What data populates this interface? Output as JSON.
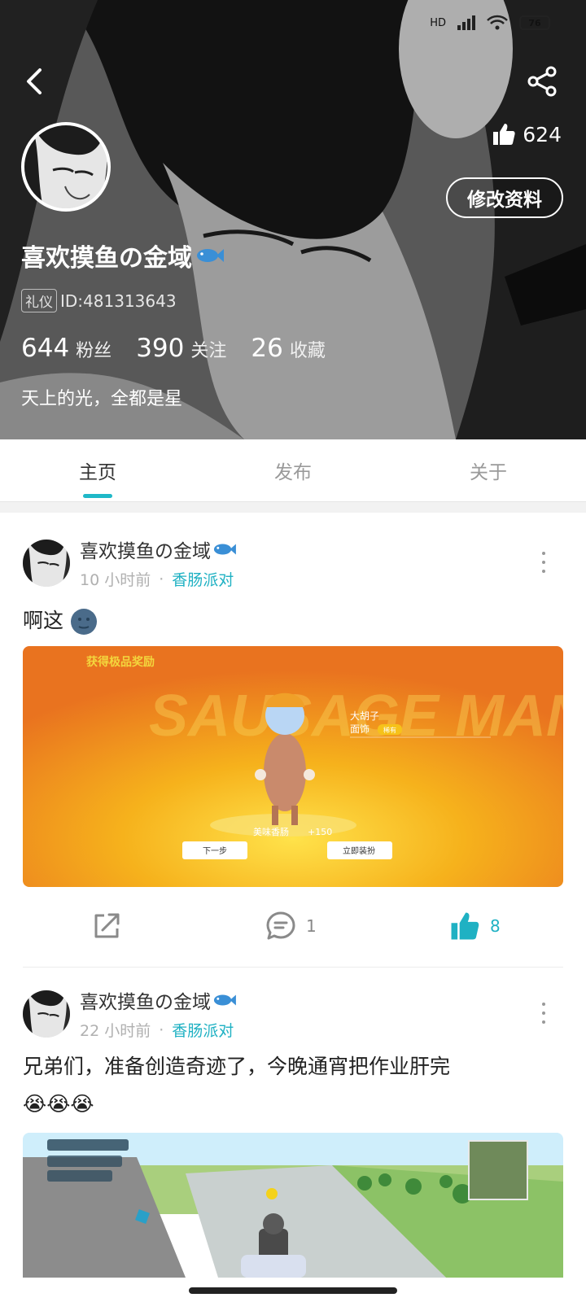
{
  "status": {
    "network": "HD",
    "battery": "76"
  },
  "profile": {
    "username": "喜欢摸鱼の金域",
    "badge": "礼仪",
    "id_text": "ID:481313643",
    "likes": "624",
    "edit_label": "修改资料",
    "stats": [
      {
        "num": "644",
        "label": "粉丝"
      },
      {
        "num": "390",
        "label": "关注"
      },
      {
        "num": "26",
        "label": "收藏"
      }
    ],
    "bio": "天上的光，全都是星"
  },
  "tabs": [
    {
      "label": "主页",
      "active": true
    },
    {
      "label": "发布",
      "active": false
    },
    {
      "label": "关于",
      "active": false
    }
  ],
  "posts": [
    {
      "author": "喜欢摸鱼の金域",
      "time": "10 小时前",
      "separator": "·",
      "topic": "香肠派对",
      "text": "啊这",
      "shares": "",
      "comments": "1",
      "likes": "8",
      "image": {
        "title": "获得极品奖励",
        "item_name": "大胡子",
        "item_type": "面饰",
        "item_tag": "稀有",
        "char_name": "美味香肠",
        "score": "+150",
        "btn_next": "下一步",
        "btn_equip": "立即装扮",
        "watermark": "SAUSAGE MAN"
      }
    },
    {
      "author": "喜欢摸鱼の金域",
      "time": "22 小时前",
      "separator": "·",
      "topic": "香肠派对",
      "text": "兄弟们，准备创造奇迹了，今晚通宵把作业肝完",
      "emoji_line": "😭😭😭"
    }
  ],
  "colors": {
    "accent": "#1fb1c3",
    "orange": "#f07a1e",
    "yellow": "#f6c21a"
  },
  "icons": [
    "back-icon",
    "share-icon",
    "thumbs-up-icon",
    "fish-icon",
    "more-vertical-icon",
    "external-share-icon",
    "comment-icon"
  ]
}
